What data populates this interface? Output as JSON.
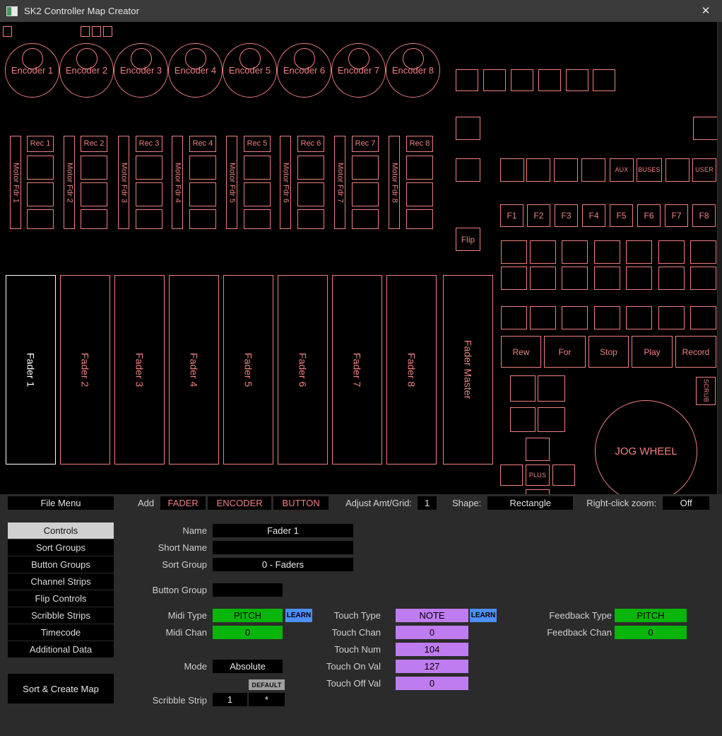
{
  "window": {
    "title": "SK2 Controller Map Creator",
    "close_label": "✕",
    "icon": "app-icon"
  },
  "canvas": {
    "encoders": [
      {
        "label": "Encoder 1"
      },
      {
        "label": "Encoder 2"
      },
      {
        "label": "Encoder 3"
      },
      {
        "label": "Encoder 4"
      },
      {
        "label": "Encoder 5"
      },
      {
        "label": "Encoder 6"
      },
      {
        "label": "Encoder 7"
      },
      {
        "label": "Encoder 8"
      }
    ],
    "motor_faders": [
      {
        "label": "Motor Fdr 1"
      },
      {
        "label": "Motor Fdr 2"
      },
      {
        "label": "Motor Fdr 3"
      },
      {
        "label": "Motor Fdr 4"
      },
      {
        "label": "Motor Fdr 5"
      },
      {
        "label": "Motor Fdr 6"
      },
      {
        "label": "Motor Fdr 7"
      },
      {
        "label": "Motor Fdr 8"
      }
    ],
    "rec_buttons": [
      {
        "label": "Rec 1"
      },
      {
        "label": "Rec 2"
      },
      {
        "label": "Rec 3"
      },
      {
        "label": "Rec 4"
      },
      {
        "label": "Rec 5"
      },
      {
        "label": "Rec 6"
      },
      {
        "label": "Rec 7"
      },
      {
        "label": "Rec 8"
      }
    ],
    "faders": [
      {
        "label": "Fader 1",
        "selected": true
      },
      {
        "label": "Fader 2",
        "selected": false
      },
      {
        "label": "Fader 3",
        "selected": false
      },
      {
        "label": "Fader 4",
        "selected": false
      },
      {
        "label": "Fader 5",
        "selected": false
      },
      {
        "label": "Fader 6",
        "selected": false
      },
      {
        "label": "Fader 7",
        "selected": false
      },
      {
        "label": "Fader 8",
        "selected": false
      }
    ],
    "fader_master": {
      "label": "Fader Master"
    },
    "flip": {
      "label": "Flip"
    },
    "named_buttons": {
      "aux": "AUX",
      "buses": "BUSES",
      "user": "USER",
      "plus": "PLUS",
      "scrub": "SCRUB"
    },
    "function_keys": [
      {
        "label": "F1"
      },
      {
        "label": "F2"
      },
      {
        "label": "F3"
      },
      {
        "label": "F4"
      },
      {
        "label": "F5"
      },
      {
        "label": "F6"
      },
      {
        "label": "F7"
      },
      {
        "label": "F8"
      }
    ],
    "transport": [
      {
        "label": "Rew"
      },
      {
        "label": "For"
      },
      {
        "label": "Stop"
      },
      {
        "label": "Play"
      },
      {
        "label": "Record"
      }
    ],
    "jog_wheel": {
      "label": "JOG WHEEL"
    },
    "colors": {
      "control_outline": "#f08080",
      "selected_outline": "#ffffff",
      "canvas_bg": "#000000"
    }
  },
  "toolbar": {
    "file_menu": "File Menu",
    "add_label": "Add",
    "add_fader": "FADER",
    "add_encoder": "ENCODER",
    "add_button": "BUTTON",
    "adjust_label": "Adjust Amt/Grid:",
    "adjust_value": "1",
    "shape_label": "Shape:",
    "shape_value": "Rectangle",
    "zoom_label": "Right-click zoom:",
    "zoom_value": "Off"
  },
  "sidebar": {
    "items": [
      {
        "label": "Controls",
        "active": true
      },
      {
        "label": "Sort Groups",
        "active": false
      },
      {
        "label": "Button Groups",
        "active": false
      },
      {
        "label": "Channel Strips",
        "active": false
      },
      {
        "label": "Flip Controls",
        "active": false
      },
      {
        "label": "Scribble Strips",
        "active": false
      },
      {
        "label": "Timecode",
        "active": false
      },
      {
        "label": "Additional Data",
        "active": false
      }
    ],
    "action": "Sort & Create Map"
  },
  "form": {
    "name_label": "Name",
    "name_value": "Fader 1",
    "short_name_label": "Short Name",
    "short_name_value": "",
    "sort_group_label": "Sort Group",
    "sort_group_value": "0 - Faders",
    "button_group_label": "Button Group",
    "button_group_value": "",
    "midi_type_label": "Midi Type",
    "midi_type_value": "PITCH",
    "midi_type_learn": "LEARN",
    "midi_chan_label": "Midi Chan",
    "midi_chan_value": "0",
    "mode_label": "Mode",
    "mode_value": "Absolute",
    "default_badge": "DEFAULT",
    "scribble_label": "Scribble Strip",
    "scribble_value_1": "1",
    "scribble_value_2": "*",
    "touch_type_label": "Touch Type",
    "touch_type_value": "NOTE",
    "touch_type_learn": "LEARN",
    "touch_chan_label": "Touch Chan",
    "touch_chan_value": "0",
    "touch_num_label": "Touch Num",
    "touch_num_value": "104",
    "touch_on_label": "Touch On Val",
    "touch_on_value": "127",
    "touch_off_label": "Touch Off Val",
    "touch_off_value": "0",
    "feedback_type_label": "Feedback Type",
    "feedback_type_value": "PITCH",
    "feedback_chan_label": "Feedback Chan",
    "feedback_chan_value": "0",
    "colors": {
      "midi": "#09b509",
      "touch": "#bf7cf0",
      "learn": "#4c8ff5"
    }
  }
}
